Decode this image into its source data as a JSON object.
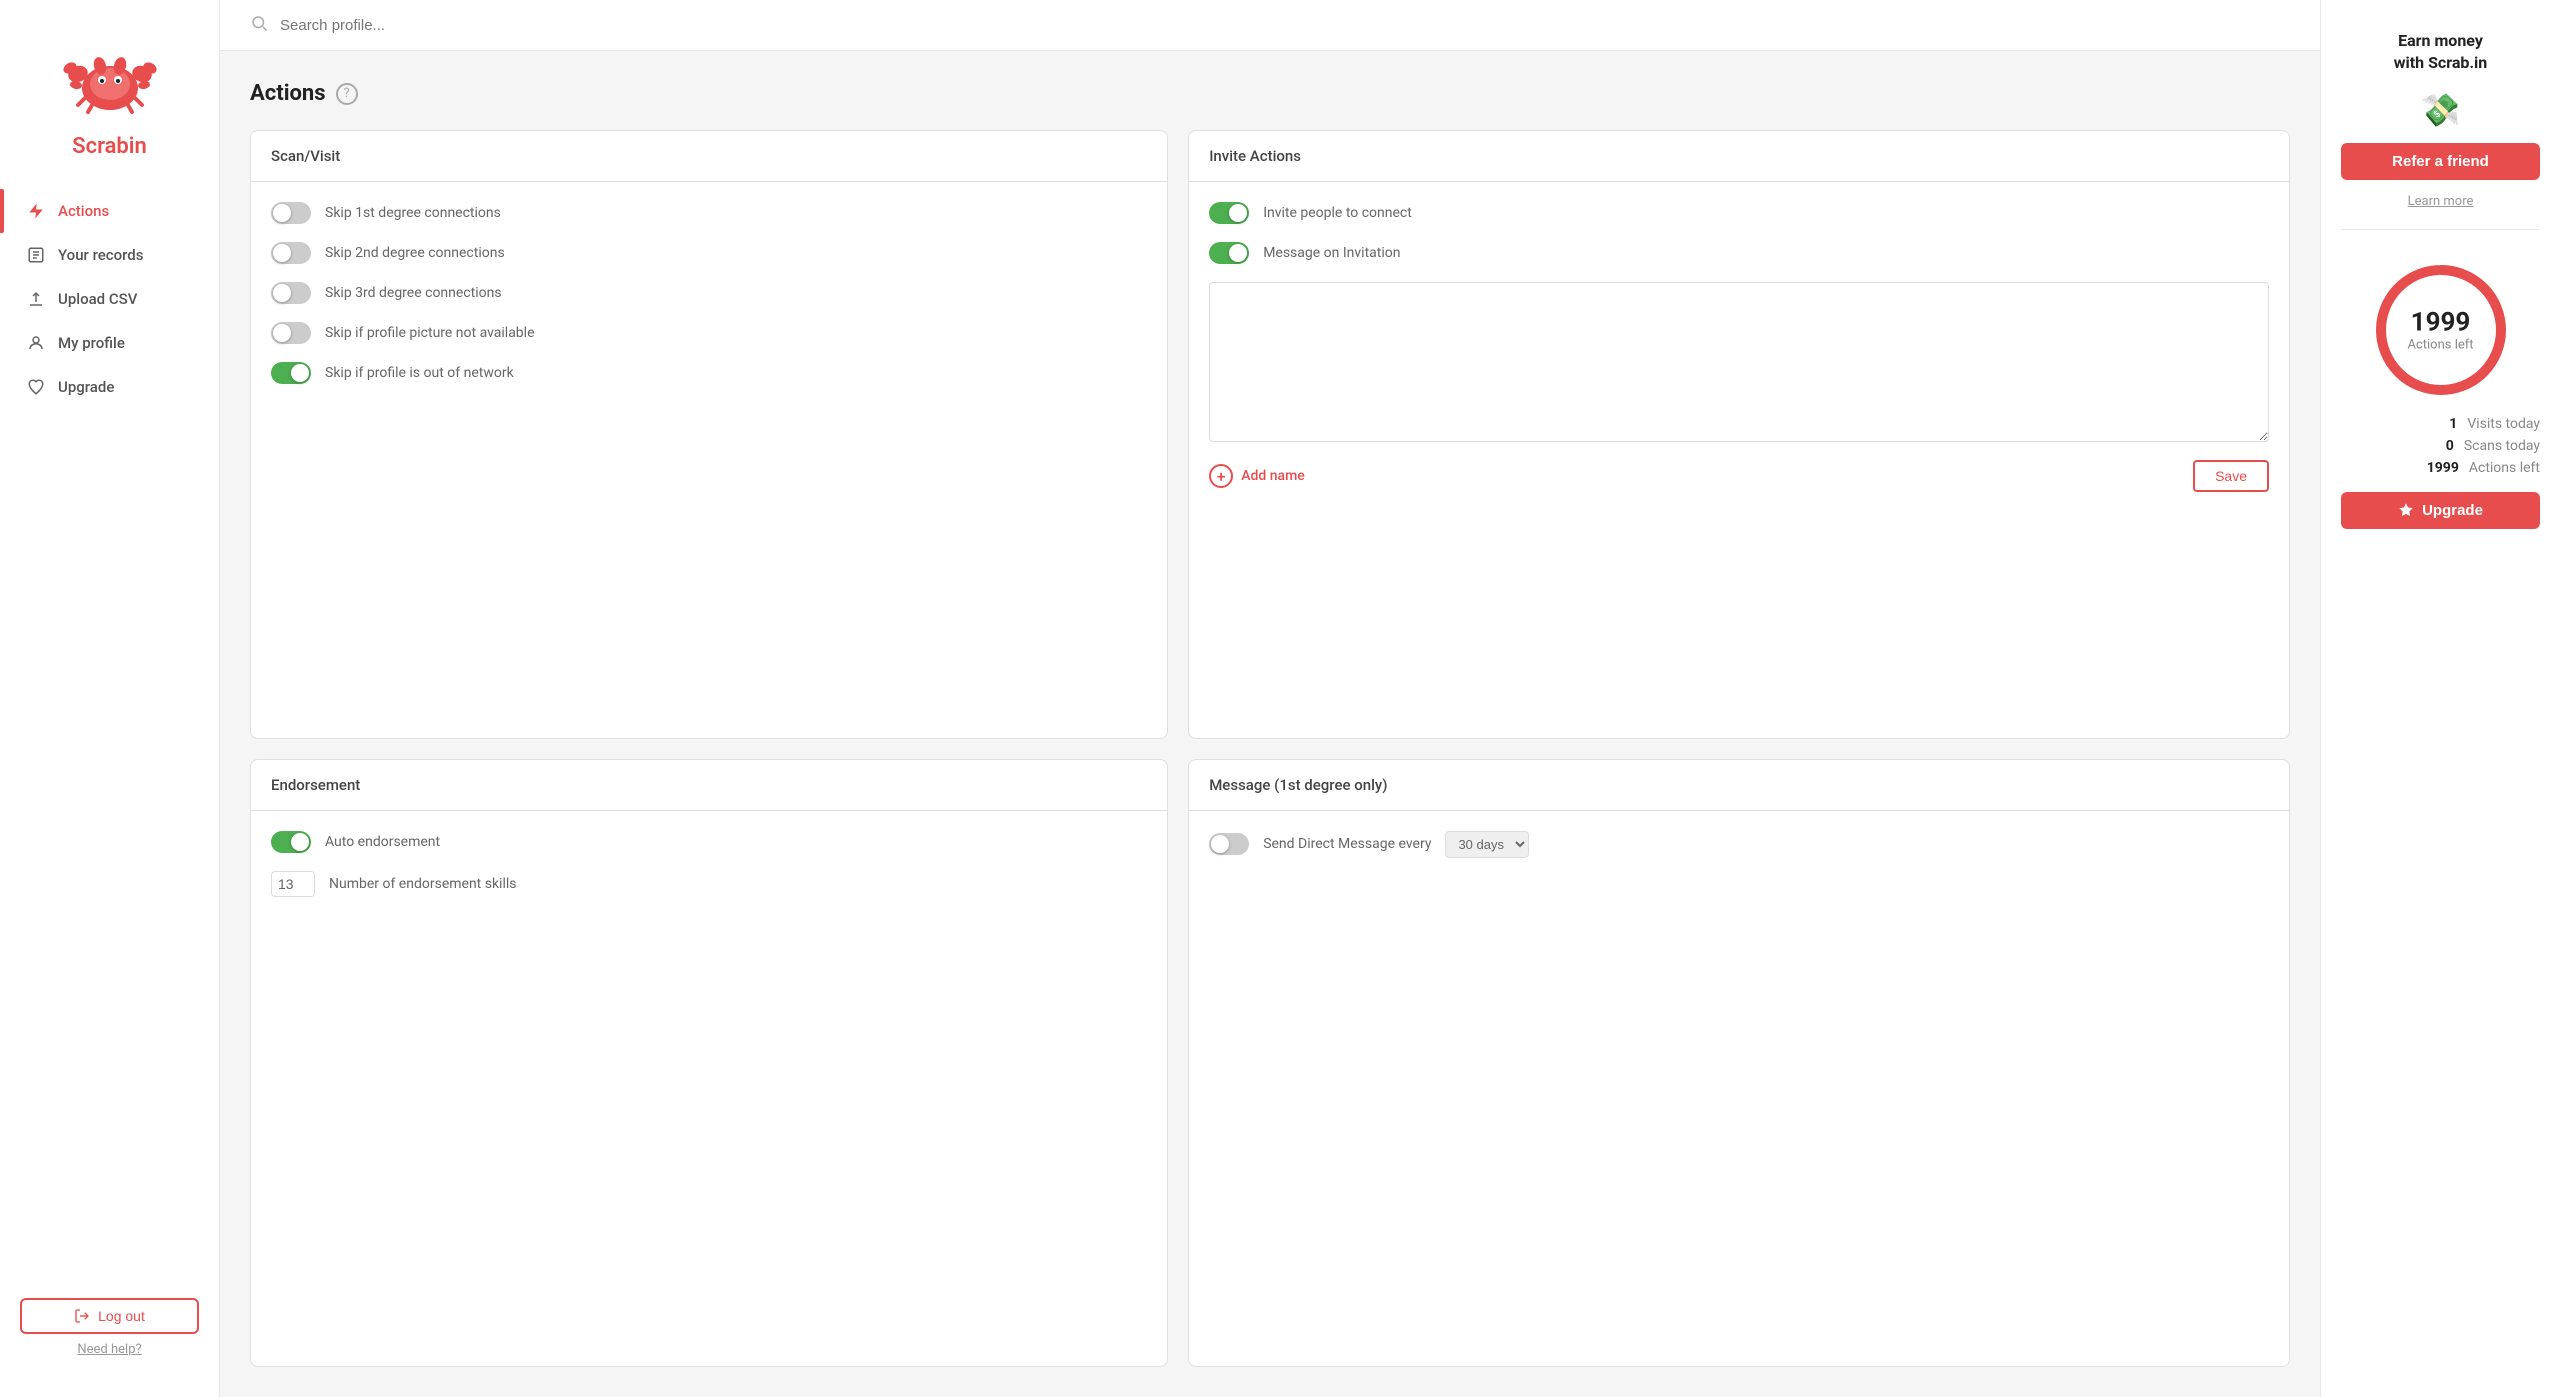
{
  "app": {
    "name": "Scrabin"
  },
  "search": {
    "placeholder": "Search profile..."
  },
  "page": {
    "title": "Actions"
  },
  "sidebar": {
    "nav_items": [
      {
        "id": "actions",
        "label": "Actions",
        "active": true
      },
      {
        "id": "records",
        "label": "Your records",
        "active": false
      },
      {
        "id": "upload",
        "label": "Upload CSV",
        "active": false
      },
      {
        "id": "profile",
        "label": "My profile",
        "active": false
      },
      {
        "id": "upgrade",
        "label": "Upgrade",
        "active": false
      }
    ],
    "logout_label": "Log out",
    "need_help_label": "Need help?"
  },
  "scan_visit": {
    "title": "Scan/Visit",
    "toggles": [
      {
        "label": "Skip 1st degree connections",
        "on": false
      },
      {
        "label": "Skip 2nd degree connections",
        "on": false
      },
      {
        "label": "Skip 3rd degree connections",
        "on": false
      },
      {
        "label": "Skip if profile picture not available",
        "on": false
      },
      {
        "label": "Skip if profile is out of network",
        "on": true
      }
    ]
  },
  "endorsement": {
    "title": "Endorsement",
    "auto_label": "Auto endorsement",
    "auto_on": true,
    "num_label": "Number of endorsement skills",
    "num_value": "13"
  },
  "invite_actions": {
    "title": "Invite Actions",
    "toggles": [
      {
        "label": "Invite people to connect",
        "on": true
      },
      {
        "label": "Message on Invitation",
        "on": true
      }
    ],
    "textarea_placeholder": "",
    "add_name_label": "Add name",
    "save_label": "Save"
  },
  "message": {
    "title": "Message (1st degree only)",
    "send_label": "Send Direct Message every",
    "send_on": false,
    "days_value": "30 days"
  },
  "right_panel": {
    "earn_title": "Earn money\nwith Scrab.in",
    "money_emoji": "💸",
    "refer_label": "Refer a friend",
    "learn_more_label": "Learn more",
    "actions_count": "1999",
    "actions_label": "Actions left",
    "stats": [
      {
        "value": "1",
        "label": "Visits today"
      },
      {
        "value": "0",
        "label": "Scans today"
      },
      {
        "value": "1999",
        "label": "Actions left"
      }
    ],
    "upgrade_label": "Upgrade"
  }
}
